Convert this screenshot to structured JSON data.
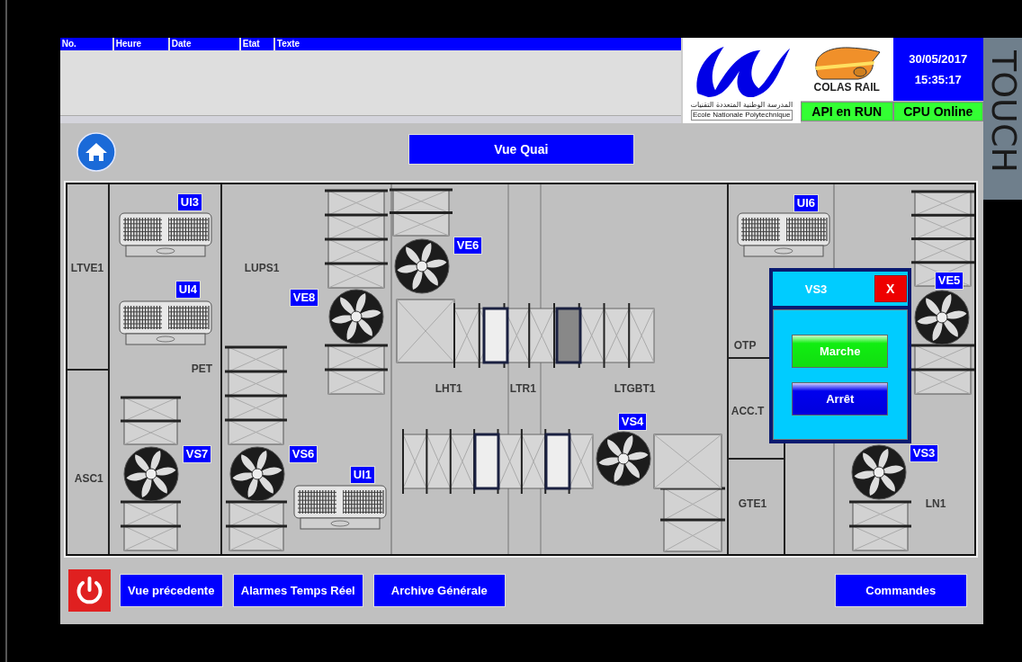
{
  "alarm_table": {
    "columns": [
      "No.",
      "Heure",
      "Date",
      "Etat",
      "Texte"
    ]
  },
  "school_logo": {
    "arabic_name": "المدرسة الوطنية المتعددة التقنيات",
    "name": "Ecole Nationale Polytechnique"
  },
  "company_logo": {
    "name": "COLAS RAIL"
  },
  "clock": {
    "date": "30/05/2017",
    "time": "15:35:17"
  },
  "status": [
    {
      "label": "API en RUN"
    },
    {
      "label": "CPU Online"
    }
  ],
  "side_label": "TOUCH",
  "view_title": "Vue Quai",
  "plan": {
    "rooms": [
      "LTVE1",
      "ASC1",
      "LUPS1",
      "PET",
      "LHT1",
      "LTR1",
      "LTGBT1",
      "OTP",
      "ACC.T",
      "GTE1",
      "LN1"
    ],
    "equipment": [
      {
        "kind": "unit",
        "tag": "UI3"
      },
      {
        "kind": "unit",
        "tag": "UI4"
      },
      {
        "kind": "unit",
        "tag": "UI1"
      },
      {
        "kind": "unit",
        "tag": "UI6"
      },
      {
        "kind": "fan",
        "tag": "VE6"
      },
      {
        "kind": "fan",
        "tag": "VE8"
      },
      {
        "kind": "fan",
        "tag": "VS7"
      },
      {
        "kind": "fan",
        "tag": "VS6"
      },
      {
        "kind": "fan",
        "tag": "VS4"
      },
      {
        "kind": "fan",
        "tag": "VE5"
      },
      {
        "kind": "fan",
        "tag": "VS3"
      }
    ]
  },
  "popup": {
    "title": "VS3",
    "close": "X",
    "buttons": [
      {
        "label": "Marche",
        "kind": "start"
      },
      {
        "label": "Arrêt",
        "kind": "stop"
      }
    ]
  },
  "footer": {
    "buttons": [
      "Vue précedente",
      "Alarmes Temps Réel",
      "Archive Générale",
      "Commandes"
    ]
  }
}
